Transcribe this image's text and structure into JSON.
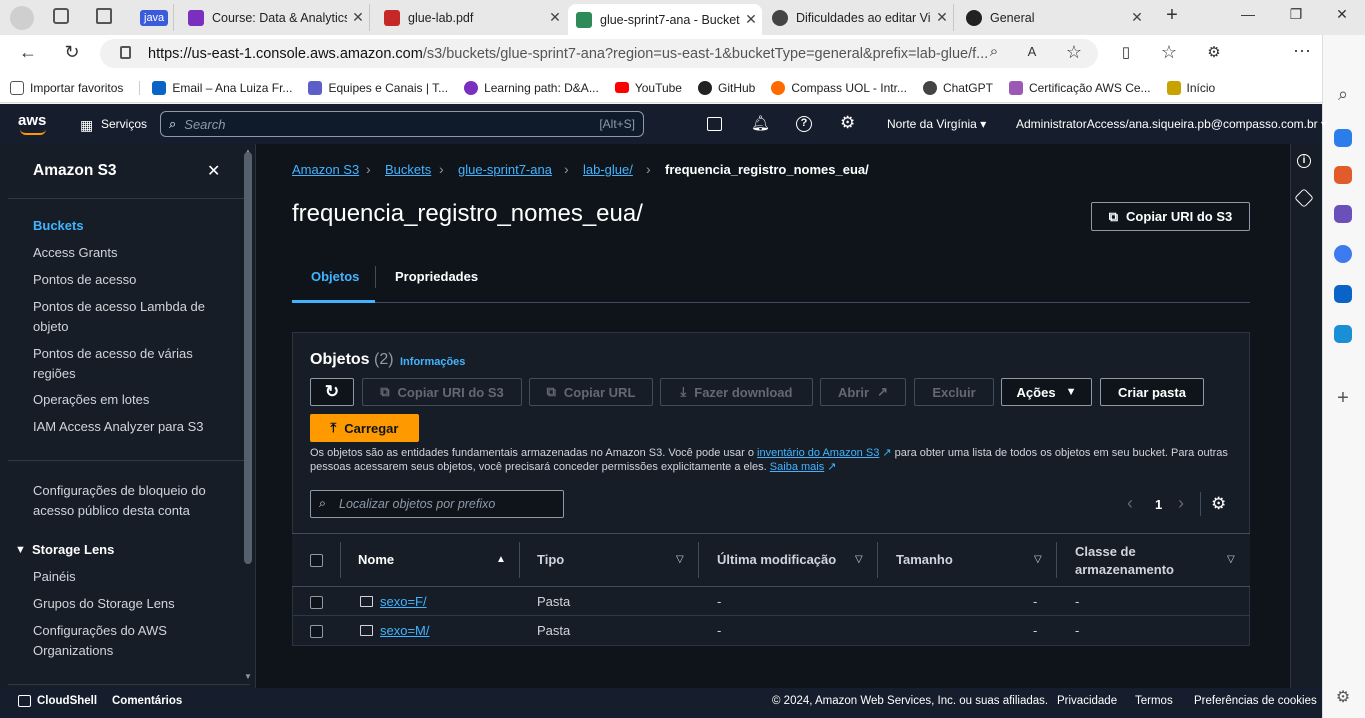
{
  "browser": {
    "tabs": [
      {
        "label": "java",
        "icon": "folder-icon",
        "color": "#3b5bdb"
      },
      {
        "label": "Course: Data & Analytics",
        "icon": "course-icon",
        "color": "#7b2fbe"
      },
      {
        "label": "glue-lab.pdf",
        "icon": "pdf-icon",
        "color": "#c62828"
      },
      {
        "label": "glue-sprint7-ana - Bucket",
        "icon": "s3-icon",
        "color": "#2e8b57"
      },
      {
        "label": "Dificuldades ao editar Vi",
        "icon": "chatgpt-icon",
        "color": "#444444"
      },
      {
        "label": "General",
        "icon": "github-icon",
        "color": "#222222"
      }
    ],
    "url_host": "https://us-east-1.console.aws.amazon.com",
    "url_rest": "/s3/buckets/glue-sprint7-ana?region=us-east-1&bucketType=general&prefix=lab-glue/f...",
    "favorites": [
      {
        "label": "Importar favoritos",
        "icon": "import-icon",
        "color": "#555555"
      },
      {
        "label": "Email – Ana Luiza Fr...",
        "icon": "outlook-icon",
        "color": "#0a64c8"
      },
      {
        "label": "Equipes e Canais | T...",
        "icon": "teams-icon",
        "color": "#5b5fc7"
      },
      {
        "label": "Learning path: D&A...",
        "icon": "learning-icon",
        "color": "#7b2fbe"
      },
      {
        "label": "YouTube",
        "icon": "youtube-icon",
        "color": "#ff0000"
      },
      {
        "label": "GitHub",
        "icon": "github-icon",
        "color": "#222222"
      },
      {
        "label": "Compass UOL - Intr...",
        "icon": "compass-icon",
        "color": "#ff6a00"
      },
      {
        "label": "ChatGPT",
        "icon": "chatgpt-icon",
        "color": "#444444"
      },
      {
        "label": "Certificação AWS Ce...",
        "icon": "cert-icon",
        "color": "#9b59b6"
      },
      {
        "label": "Início",
        "icon": "home-icon",
        "color": "#c8a200"
      }
    ]
  },
  "aws": {
    "logo": "aws",
    "services": "Serviços",
    "search_placeholder": "Search",
    "search_shortcut": "[Alt+S]",
    "region": "Norte da Virgínia",
    "account": "AdministratorAccess/ana.siqueira.pb@compasso.com.br"
  },
  "sidebar": {
    "title": "Amazon S3",
    "items": [
      "Buckets",
      "Access Grants",
      "Pontos de acesso",
      "Pontos de acesso Lambda de objeto",
      "Pontos de acesso de várias regiões",
      "Operações em lotes",
      "IAM Access Analyzer para S3"
    ],
    "block": "Configurações de bloqueio do acesso público desta conta",
    "storage_lens": "Storage Lens",
    "lens_items": [
      "Painéis",
      "Grupos do Storage Lens",
      "Configurações do AWS Organizations"
    ]
  },
  "breadcrumb": [
    "Amazon S3",
    "Buckets",
    "glue-sprint7-ana",
    "lab-glue/",
    "frequencia_registro_nomes_eua/"
  ],
  "page_title": "frequencia_registro_nomes_eua/",
  "copy_uri_top": "Copiar URI do S3",
  "tabs": [
    "Objetos",
    "Propriedades"
  ],
  "objects": {
    "heading": "Objetos",
    "count": "(2)",
    "info": "Informações",
    "buttons": {
      "copy_uri": "Copiar URI do S3",
      "copy_url": "Copiar URL",
      "download": "Fazer download",
      "open": "Abrir",
      "delete": "Excluir",
      "actions": "Ações",
      "create_folder": "Criar pasta",
      "upload": "Carregar"
    },
    "desc_1": "Os objetos são as entidades fundamentais armazenadas no Amazon S3. Você pode usar o ",
    "desc_link1": "inventário do Amazon S3",
    "desc_2": " para obter uma lista de todos os objetos em seu bucket. Para outras pessoas acessarem seus objetos, você precisará conceder permissões explicitamente a eles. ",
    "desc_link2": "Saiba mais",
    "filter_placeholder": "Localizar objetos por prefixo",
    "page": "1",
    "columns": [
      "Nome",
      "Tipo",
      "Última modificação",
      "Tamanho",
      "Classe de armazenamento"
    ],
    "rows": [
      {
        "name": "sexo=F/",
        "type": "Pasta",
        "modified": "-",
        "size": "-",
        "class": "-"
      },
      {
        "name": "sexo=M/",
        "type": "Pasta",
        "modified": "-",
        "size": "-",
        "class": "-"
      }
    ]
  },
  "footer": {
    "cloudshell": "CloudShell",
    "comments": "Comentários",
    "copyright": "© 2024, Amazon Web Services, Inc. ou suas afiliadas.",
    "privacy": "Privacidade",
    "terms": "Termos",
    "cookies": "Preferências de cookies"
  }
}
